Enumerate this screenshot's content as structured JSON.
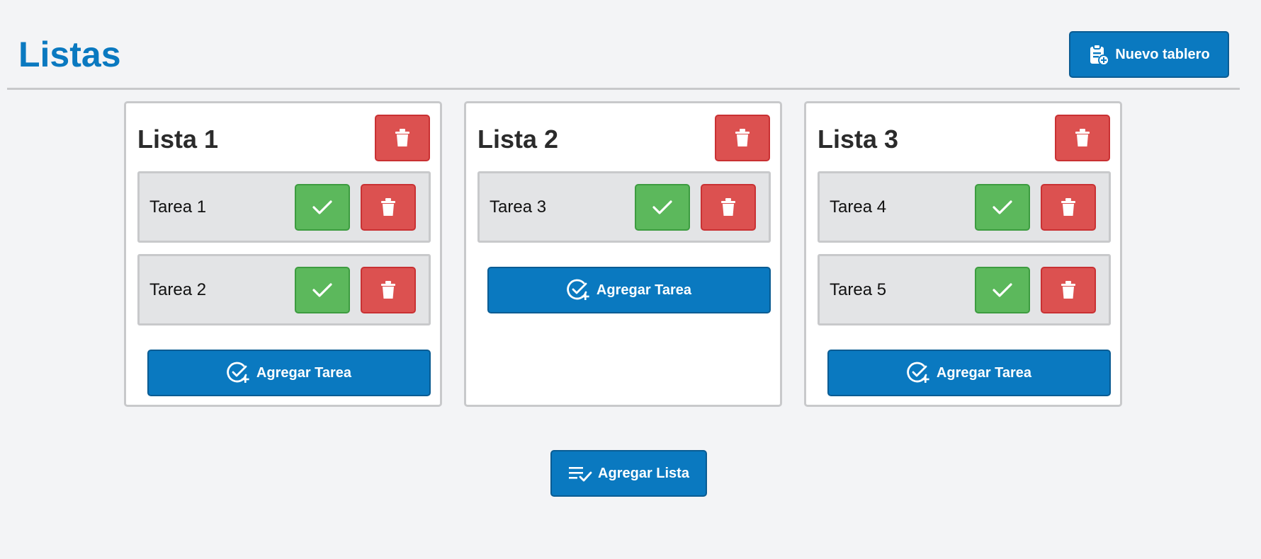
{
  "header": {
    "title": "Listas",
    "new_board_label": "Nuevo tablero"
  },
  "lists": [
    {
      "title": "Lista 1",
      "tasks": [
        {
          "label": "Tarea 1"
        },
        {
          "label": "Tarea 2"
        }
      ],
      "add_task_label": "Agregar Tarea"
    },
    {
      "title": "Lista 2",
      "tasks": [
        {
          "label": "Tarea 3"
        }
      ],
      "add_task_label": "Agregar Tarea"
    },
    {
      "title": "Lista 3",
      "tasks": [
        {
          "label": "Tarea 4"
        },
        {
          "label": "Tarea 5"
        }
      ],
      "add_task_label": "Agregar Tarea"
    }
  ],
  "footer": {
    "add_list_label": "Agregar Lista"
  },
  "icons": {
    "new_board": "clipboard-plus-icon",
    "delete": "trash-icon",
    "complete": "check-icon",
    "add_task": "circle-check-plus-icon",
    "add_list": "list-check-icon"
  },
  "colors": {
    "primary": "#0a79c0",
    "danger": "#dc5150",
    "success": "#5cb85c",
    "background": "#f3f4f6",
    "task_background": "#e3e4e6"
  }
}
